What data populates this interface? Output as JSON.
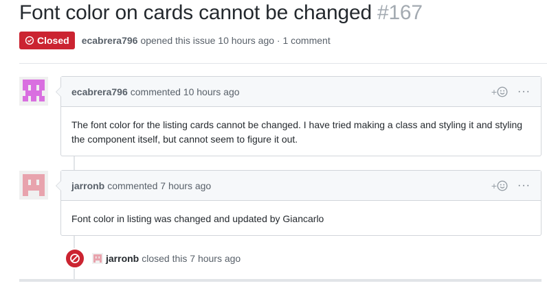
{
  "issue": {
    "title": "Font color on cards cannot be changed",
    "number": "#167",
    "state": "Closed",
    "author": "ecabrera796",
    "opened_text": "opened this issue 10 hours ago · 1 comment"
  },
  "comments": [
    {
      "author": "ecabrera796",
      "meta": "commented 10 hours ago",
      "body": "The font color for the listing cards cannot be changed. I have tried making a class and styling it and styling the component itself, but cannot seem to figure it out.",
      "reaction_plus": "+",
      "more": "···"
    },
    {
      "author": "jarronb",
      "meta": "commented 7 hours ago",
      "body": "Font color in listing was changed and updated by Giancarlo",
      "reaction_plus": "+",
      "more": "···"
    }
  ],
  "event": {
    "actor": "jarronb",
    "text": "closed this 7 hours ago",
    "icon": "circle-slash-icon"
  },
  "colors": {
    "closed_red": "#cb2431",
    "avatar_ecabrera": "#d96fe0",
    "avatar_jarronb": "#e8a3ad"
  }
}
